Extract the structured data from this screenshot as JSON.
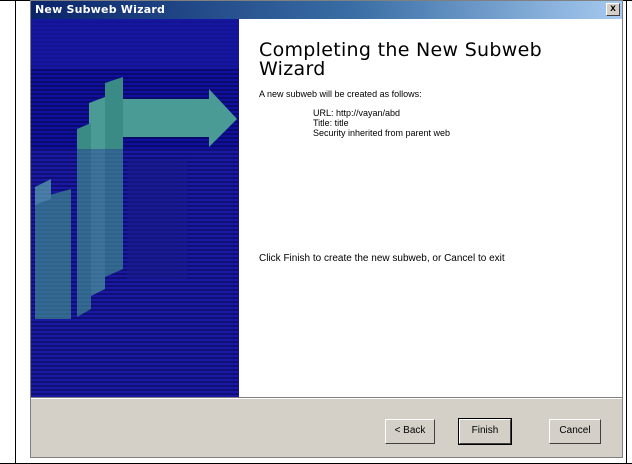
{
  "window": {
    "title": "New Subweb Wizard",
    "close_label": "x"
  },
  "main": {
    "heading": "Completing the New Subweb Wizard",
    "intro": "A new subweb will be created as follows:",
    "details": [
      "URL: http://vayan/abd",
      "Title: title",
      "Security inherited from parent web"
    ],
    "finish_note": "Click Finish to create the new subweb, or Cancel to exit"
  },
  "buttons": {
    "back": "< Back",
    "finish": "Finish",
    "cancel": "Cancel"
  },
  "colors": {
    "banner_blue": "#10108a",
    "banner_teal": "#3a8a86",
    "dialog_gray": "#d4d0c8"
  }
}
